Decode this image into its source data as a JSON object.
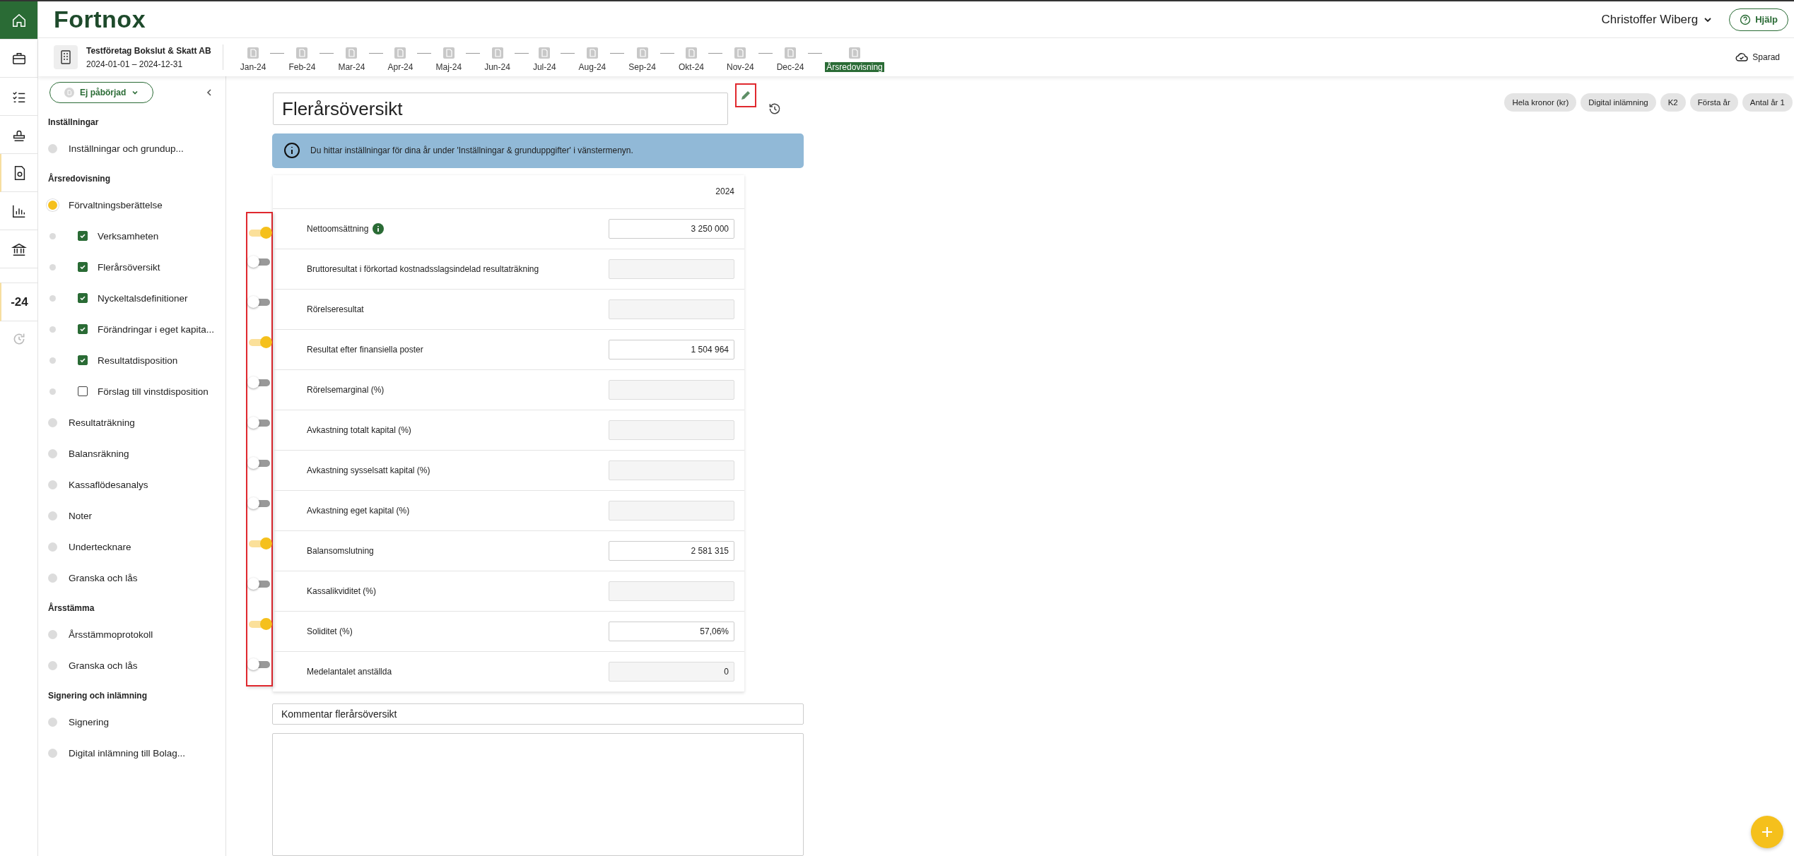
{
  "brand": {
    "logo": "Fortnox"
  },
  "header": {
    "user_name": "Christoffer Wiberg",
    "help_button": "Hjälp"
  },
  "rail": [
    {
      "selected": true
    },
    {
      "selected": false
    },
    {
      "selected": false
    },
    {
      "selected": false
    },
    {
      "selected": false
    },
    {
      "selected": false
    },
    {
      "selected": false
    }
  ],
  "rail_year": "-24",
  "company": {
    "name": "Testföretag Bokslut & Skatt AB",
    "period": "2024-01-01 – 2024-12-31"
  },
  "timeline": [
    {
      "label": "Jan-24",
      "selected": false
    },
    {
      "label": "Feb-24",
      "selected": false
    },
    {
      "label": "Mar-24",
      "selected": false
    },
    {
      "label": "Apr-24",
      "selected": false
    },
    {
      "label": "Maj-24",
      "selected": false
    },
    {
      "label": "Jun-24",
      "selected": false
    },
    {
      "label": "Jul-24",
      "selected": false
    },
    {
      "label": "Aug-24",
      "selected": false
    },
    {
      "label": "Sep-24",
      "selected": false
    },
    {
      "label": "Okt-24",
      "selected": false
    },
    {
      "label": "Nov-24",
      "selected": false
    },
    {
      "label": "Dec-24",
      "selected": false
    },
    {
      "label": "Årsredovisning",
      "selected": true
    }
  ],
  "save_status": "Sparad",
  "sidebar": {
    "status_button": "Ej påbörjad",
    "sections": [
      {
        "title": "Inställningar",
        "items": [
          {
            "label": "Inställningar och grundup...",
            "selected": false
          }
        ]
      },
      {
        "title": "Årsredovisning",
        "items": [
          {
            "label": "Förvaltningsberättelse",
            "selected": true,
            "children": [
              {
                "label": "Verksamheten",
                "checked": true
              },
              {
                "label": "Flerårsöversikt",
                "checked": true
              },
              {
                "label": "Nyckeltalsdefinitioner",
                "checked": true
              },
              {
                "label": "Förändringar i eget kapita...",
                "checked": true
              },
              {
                "label": "Resultatdisposition",
                "checked": true
              },
              {
                "label": "Förslag till vinstdisposition",
                "checked": false
              }
            ]
          },
          {
            "label": "Resultaträkning",
            "selected": false
          },
          {
            "label": "Balansräkning",
            "selected": false
          },
          {
            "label": "Kassaflödesanalys",
            "selected": false
          },
          {
            "label": "Noter",
            "selected": false
          },
          {
            "label": "Undertecknare",
            "selected": false
          },
          {
            "label": "Granska och lås",
            "selected": false
          }
        ]
      },
      {
        "title": "Årsstämma",
        "items": [
          {
            "label": "Årsstämmoprotokoll",
            "selected": false
          },
          {
            "label": "Granska och lås",
            "selected": false
          }
        ]
      },
      {
        "title": "Signering och inlämning",
        "items": [
          {
            "label": "Signering",
            "selected": false
          },
          {
            "label": "Digital inlämning till Bolag...",
            "selected": false
          }
        ]
      }
    ]
  },
  "chips": [
    "Hela kronor (kr)",
    "Digital inlämning",
    "K2",
    "Första år",
    "Antal år 1"
  ],
  "document": {
    "title": "Flerårsöversikt",
    "info": "Du hittar inställningar för dina år under 'Inställningar & grunduppgifter' i vänstermenyn.",
    "year": "2024",
    "rows": [
      {
        "label": "Nettoomsättning",
        "on": true,
        "has_info": true,
        "value": "3 250 000"
      },
      {
        "label": "Bruttoresultat i förkortad kostnadsslagsindelad resultaträkning",
        "on": false,
        "has_info": false,
        "value": ""
      },
      {
        "label": "Rörelseresultat",
        "on": false,
        "has_info": false,
        "value": ""
      },
      {
        "label": "Resultat efter finansiella poster",
        "on": true,
        "has_info": false,
        "value": "1 504 964"
      },
      {
        "label": "Rörelsemarginal (%)",
        "on": false,
        "has_info": false,
        "value": ""
      },
      {
        "label": "Avkastning totalt kapital (%)",
        "on": false,
        "has_info": false,
        "value": ""
      },
      {
        "label": "Avkastning sysselsatt kapital (%)",
        "on": false,
        "has_info": false,
        "value": ""
      },
      {
        "label": "Avkastning eget kapital (%)",
        "on": false,
        "has_info": false,
        "value": ""
      },
      {
        "label": "Balansomslutning",
        "on": true,
        "has_info": false,
        "value": "2 581 315"
      },
      {
        "label": "Kassalikviditet (%)",
        "on": false,
        "has_info": false,
        "value": ""
      },
      {
        "label": "Soliditet (%)",
        "on": true,
        "has_info": false,
        "value": "57,06%"
      },
      {
        "label": "Medelantalet anställda",
        "on": false,
        "has_info": false,
        "value": "0"
      }
    ],
    "comment_title": "Kommentar flerårsöversikt"
  }
}
